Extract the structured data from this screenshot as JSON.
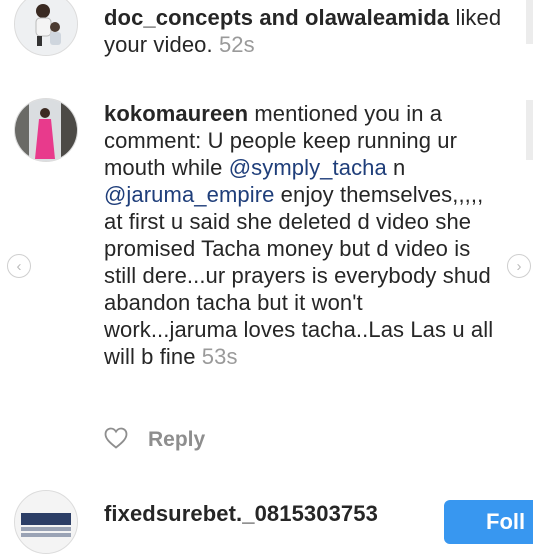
{
  "notifications": [
    {
      "users": "doc_concepts and olawaleamida",
      "action": "liked your video.",
      "time": "52s"
    },
    {
      "username": "kokomaureen",
      "text_1": " mentioned you in a comment: U people keep running ur mouth while ",
      "mention_1": "@symply_tacha",
      "text_2": " n ",
      "mention_2": "@jaruma_empire",
      "text_3": " enjoy themselves,,,,, at first u said she deleted d video she promised Tacha money but d video is still dere...ur prayers is everybody shud abandon tacha but it won't work...jaruma loves tacha..Las Las u all will b fine ",
      "time": "53s",
      "reply_label": "Reply"
    },
    {
      "username": "fixedsurebet._0815303753",
      "follow_label": "Foll"
    }
  ],
  "colors": {
    "text": "#262626",
    "mention": "#1f3e7a",
    "muted": "#9a9a9a",
    "follow_button": "#3897f0"
  },
  "icons": {
    "reply": "heart-outline-icon",
    "carousel_prev": "chevron-left-icon",
    "carousel_next": "chevron-right-icon"
  }
}
